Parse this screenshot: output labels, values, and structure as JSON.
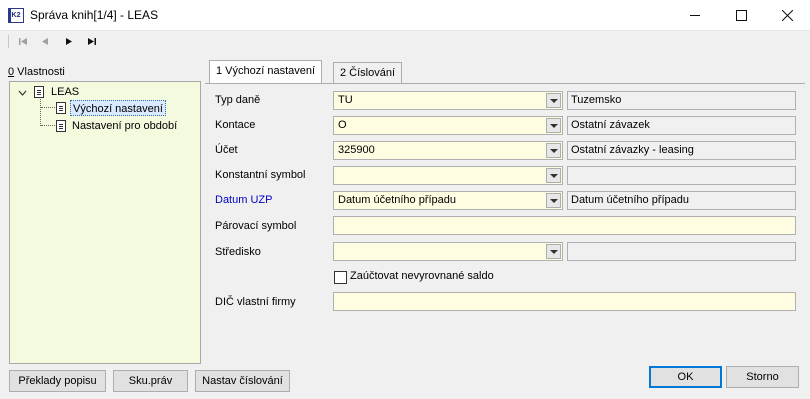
{
  "window": {
    "title": "Správa knih[1/4] - LEAS",
    "icon_label": "K2",
    "controls": [
      "minimize-icon",
      "maximize-icon",
      "close-icon"
    ]
  },
  "navigation": {
    "buttons": [
      "first-record-icon",
      "previous-record-icon",
      "next-record-icon",
      "last-record-icon"
    ]
  },
  "tree": {
    "label_hotkey": "0",
    "label_rest": " Vlastnosti",
    "root": "LEAS",
    "items": [
      {
        "label": "Výchozí nastavení",
        "selected": true
      },
      {
        "label": "Nastavení pro období",
        "selected": false
      }
    ]
  },
  "tabs": [
    {
      "label": "1 Výchozí nastavení",
      "active": true
    },
    {
      "label": "2 Číslování",
      "active": false
    }
  ],
  "form": {
    "tax_type": {
      "label": "Typ daně",
      "value": "TU",
      "desc": "Tuzemsko"
    },
    "account_class": {
      "label": "Kontace",
      "value": "O",
      "desc": "Ostatní závazek"
    },
    "account": {
      "label": "Účet",
      "value": "325900",
      "desc": "Ostatní závazky - leasing"
    },
    "const_symbol": {
      "label": "Konstantní symbol",
      "value": "",
      "desc": ""
    },
    "uzp_date": {
      "label": "Datum UZP",
      "value": "Datum účetního případu",
      "desc": "Datum účetního případu"
    },
    "pairing_symbol": {
      "label": "Párovací symbol",
      "value": ""
    },
    "cost_center": {
      "label": "Středisko",
      "value": "",
      "desc": ""
    },
    "unbalanced": {
      "label": "Zaúčtovat nevyrovnané saldo",
      "checked": false
    },
    "vat_id": {
      "label": "DIČ vlastní firmy",
      "value": ""
    }
  },
  "buttons": {
    "translations": "Překlady popisu",
    "sku_rights": "Sku.práv",
    "numbering": "Nastav číslování",
    "ok": "OK",
    "cancel": "Storno"
  },
  "colors": {
    "field_bg": "#fffde1",
    "tree_bg": "#f4fade",
    "accent": "#0078d7",
    "label_blue": "#0000c0"
  }
}
